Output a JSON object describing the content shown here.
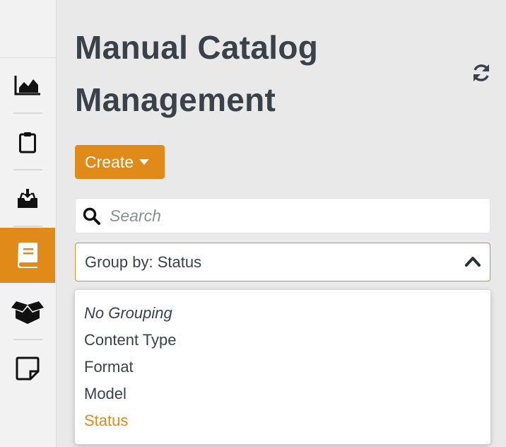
{
  "page": {
    "title": "Manual Catalog Management"
  },
  "toolbar": {
    "create_label": "Create"
  },
  "search": {
    "placeholder": "Search",
    "value": ""
  },
  "group_by": {
    "label": "Group by: Status"
  },
  "group_options": [
    {
      "label": "No Grouping",
      "selected": false
    },
    {
      "label": "Content Type",
      "selected": false
    },
    {
      "label": "Format",
      "selected": false
    },
    {
      "label": "Model",
      "selected": false
    },
    {
      "label": "Status",
      "selected": true
    }
  ],
  "sidebar": {
    "items": [
      {
        "icon": "chart-area-icon",
        "active": false
      },
      {
        "icon": "clipboard-icon",
        "active": false
      },
      {
        "icon": "inbox-download-icon",
        "active": false
      },
      {
        "icon": "book-icon",
        "active": true
      },
      {
        "icon": "box-open-icon",
        "active": false
      },
      {
        "icon": "sticky-note-icon",
        "active": false
      }
    ]
  },
  "colors": {
    "accent": "#e08a1a",
    "text": "#3b4248",
    "background": "#e9e9e9"
  }
}
